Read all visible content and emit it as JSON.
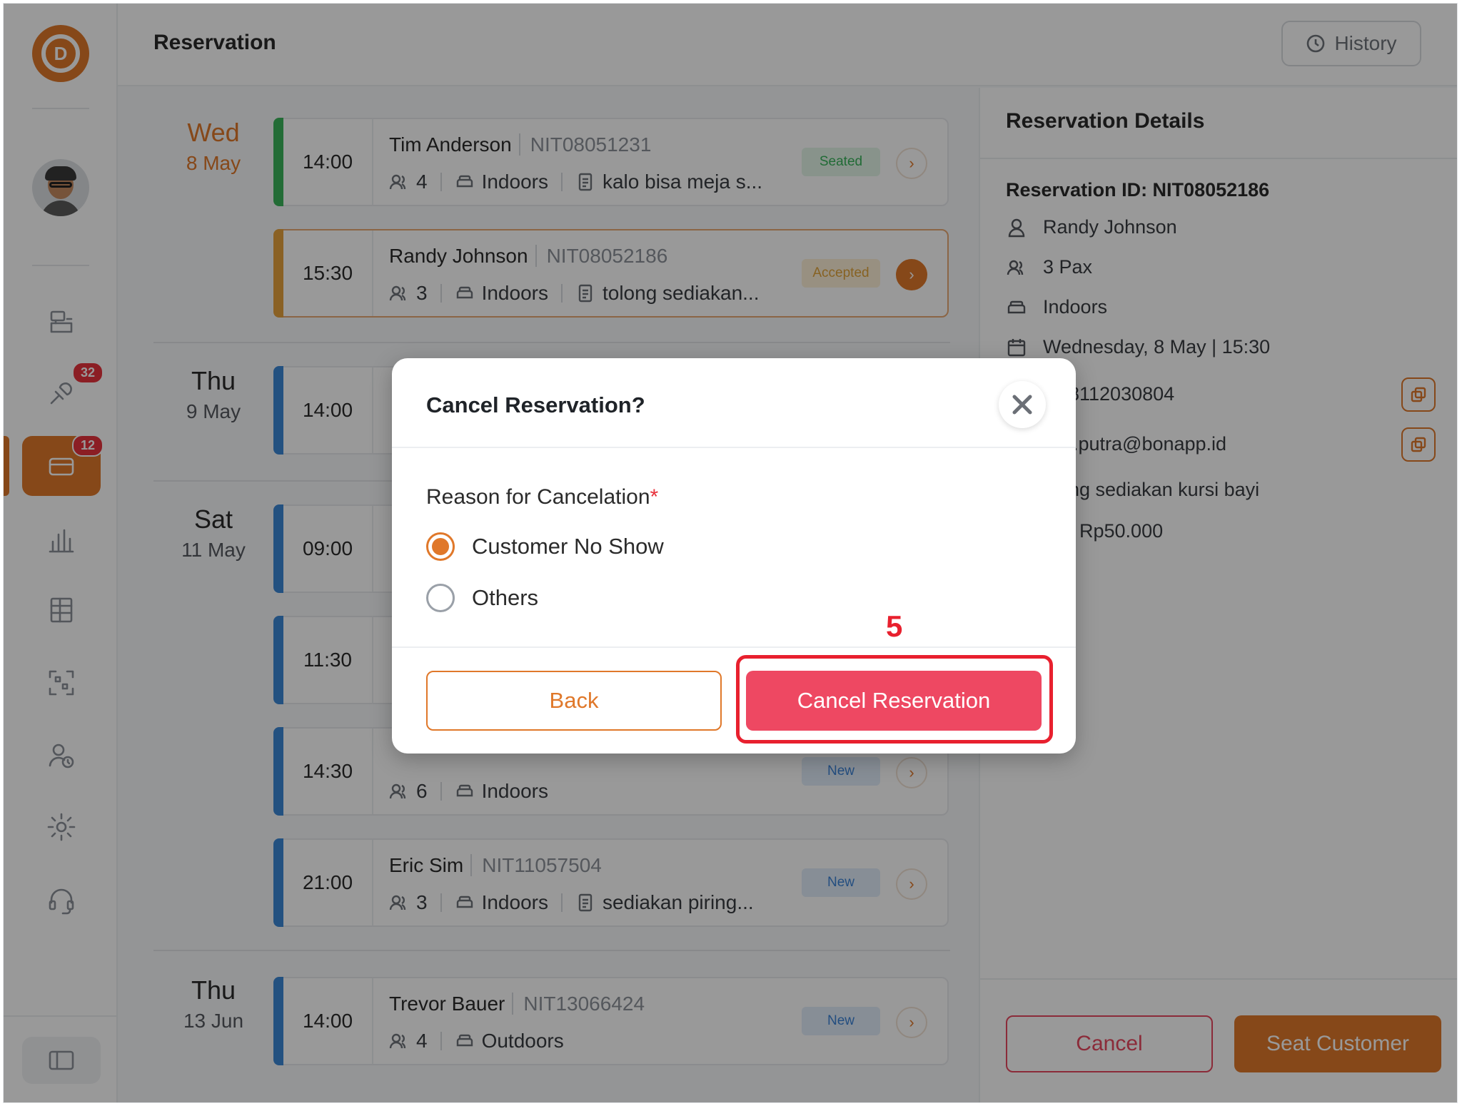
{
  "header": {
    "title": "Reservation",
    "history_label": "History"
  },
  "sidebar": {
    "badges": {
      "waitlist": "32",
      "reservation": "12"
    },
    "icons": [
      "cashier-icon",
      "waitlist-icon",
      "reservation-icon",
      "report-icon",
      "table-layout-icon",
      "qr-code-icon",
      "staff-icon",
      "settings-icon",
      "support-icon"
    ]
  },
  "days": [
    {
      "name": "Wed",
      "date": "8 May"
    },
    {
      "name": "Thu",
      "date": "9 May"
    },
    {
      "name": "Sat",
      "date": "11 May"
    },
    {
      "name": "Thu",
      "date": "13 Jun"
    }
  ],
  "reservations": [
    {
      "time": "14:00",
      "name": "Tim Anderson",
      "id": "NIT08051231",
      "pax": "4",
      "area": "Indoors",
      "note": "kalo bisa meja s...",
      "status": "Seated"
    },
    {
      "time": "15:30",
      "name": "Randy Johnson",
      "id": "NIT08052186",
      "pax": "3",
      "area": "Indoors",
      "note": "tolong sediakan...",
      "status": "Accepted"
    },
    {
      "time": "14:00"
    },
    {
      "time": "09:00"
    },
    {
      "time": "11:30"
    },
    {
      "time": "14:30",
      "pax": "6",
      "area": "Indoors",
      "status": "New"
    },
    {
      "time": "21:00",
      "name": "Eric Sim",
      "id": "NIT11057504",
      "pax": "3",
      "area": "Indoors",
      "note": "sediakan piring...",
      "status": "New"
    },
    {
      "time": "14:00",
      "name": "Trevor Bauer",
      "id": "NIT13066424",
      "pax": "4",
      "area": "Outdoors",
      "status": "New"
    }
  ],
  "details": {
    "title": "Reservation Details",
    "reservation_id": "Reservation ID: NIT08052186",
    "guest": "Randy Johnson",
    "pax": "3 Pax",
    "area": "Indoors",
    "datetime": "Wednesday, 8 May | 15:30",
    "phone": "8112030804",
    "email": "l.putra@bonapp.id",
    "note": "ng sediakan kursi bayi",
    "deposit": ": Rp50.000",
    "cancel_label": "Cancel",
    "seat_label": "Seat Customer"
  },
  "modal": {
    "title": "Cancel Reservation?",
    "reason_label": "Reason for Cancelation",
    "required_mark": "*",
    "options": [
      "Customer No Show",
      "Others"
    ],
    "selected_option": "Customer No Show",
    "back_label": "Back",
    "confirm_label": "Cancel Reservation",
    "step_marker": "5"
  },
  "colors": {
    "brand": "#e0782a",
    "danger": "#ee4862",
    "highlight": "#e8202e"
  }
}
